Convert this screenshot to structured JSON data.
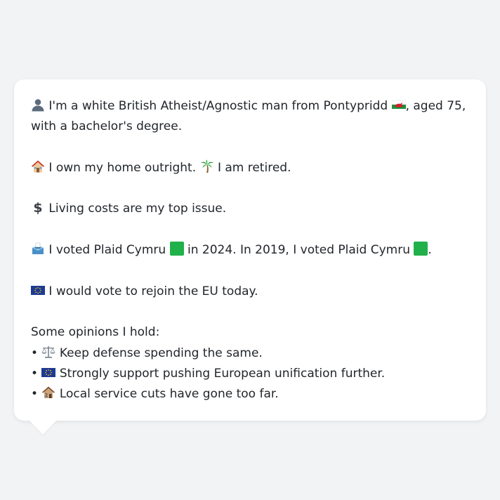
{
  "profile": {
    "identity": {
      "lead": "I'm a white British Atheist/Agnostic man from Pontypridd",
      "tail": ", aged 75,",
      "line2": "with a bachelor's degree."
    },
    "home": {
      "own": "I own my home outright.",
      "retired": "I am retired."
    },
    "issue": "Living costs are my top issue.",
    "vote": {
      "part1": "I voted Plaid Cymru",
      "part2": "in 2024. In 2019, I voted Plaid Cymru",
      "end": ".",
      "party_color": "#21b14b"
    },
    "eu": "I would vote to rejoin the EU today.",
    "opinions": {
      "heading": "Some opinions I hold:",
      "bullet": "•",
      "items": [
        "Keep defense spending the same.",
        "Strongly support pushing European unification further.",
        "Local service cuts have gone too far."
      ]
    }
  },
  "icons": {
    "person": "person-icon",
    "wales_flag": "wales-flag-icon",
    "house": "house-icon",
    "palm": "palm-tree-icon",
    "dollar": "dollar-sign-icon",
    "ballot": "ballot-box-icon",
    "party_square": "green-square-icon",
    "eu_flag": "eu-flag-icon",
    "scales": "balance-scale-icon",
    "derelict_house": "derelict-house-icon"
  },
  "colors": {
    "background": "#f2f3f5",
    "card": "#ffffff",
    "text": "#22262b",
    "eu_blue": "#1f3a93",
    "eu_star": "#ffd400"
  }
}
